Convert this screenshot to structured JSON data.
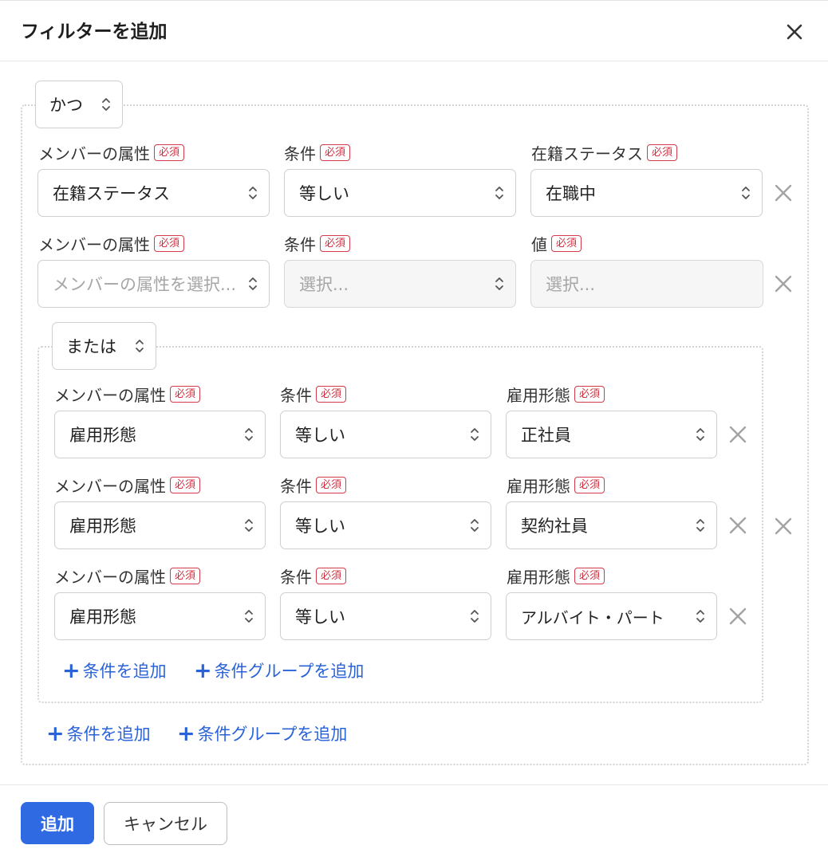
{
  "dialog": {
    "title": "フィルターを追加"
  },
  "labels": {
    "required_badge": "必須",
    "attr_label": "メンバーの属性",
    "cond_label": "条件",
    "add_condition": "条件を追加",
    "add_group": "条件グループを追加"
  },
  "outer_group": {
    "logic": "かつ",
    "rows": [
      {
        "attribute": "在籍ステータス",
        "condition": "等しい",
        "value_label": "在籍ステータス",
        "value": "在職中"
      },
      {
        "attribute_placeholder": "メンバーの属性を選択...",
        "condition_placeholder": "選択...",
        "value_label": "値",
        "value_placeholder": "選択..."
      }
    ]
  },
  "inner_group": {
    "logic": "または",
    "rows": [
      {
        "attribute": "雇用形態",
        "condition": "等しい",
        "value_label": "雇用形態",
        "value": "正社員"
      },
      {
        "attribute": "雇用形態",
        "condition": "等しい",
        "value_label": "雇用形態",
        "value": "契約社員"
      },
      {
        "attribute": "雇用形態",
        "condition": "等しい",
        "value_label": "雇用形態",
        "value": "アルバイト・パート"
      }
    ]
  },
  "footer": {
    "primary": "追加",
    "secondary": "キャンセル"
  },
  "colors": {
    "accent": "#2f6ae3",
    "link": "#2a62d8",
    "required": "#cf2f3f",
    "border": "#cfcfcf"
  },
  "icons": {
    "close": "close-icon",
    "chevron": "chevron-up-down-icon",
    "remove": "x-icon",
    "add": "plus-icon"
  }
}
